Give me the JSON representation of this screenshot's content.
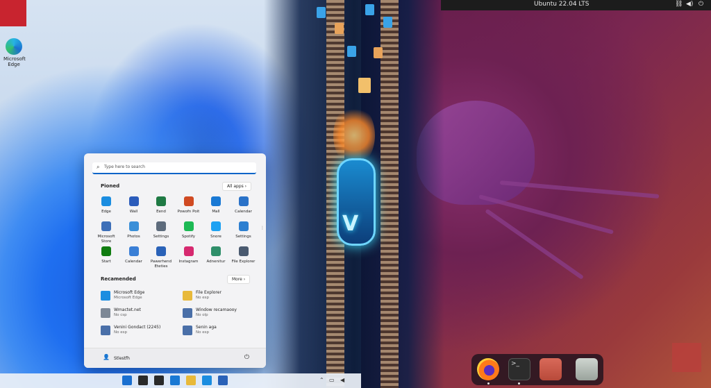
{
  "ubuntu": {
    "top_bar_title": "Ubuntu 22.04 LTS",
    "tray_icons": [
      "network-icon",
      "volume-icon",
      "power-icon"
    ],
    "dock": [
      "firefox-icon",
      "terminal-icon",
      "files-icon",
      "trash-icon"
    ]
  },
  "desktop": {
    "edge_label": "Microsoft Edge"
  },
  "start_menu": {
    "search_placeholder": "Type here to search",
    "pinned_title": "Pioned",
    "all_apps_label": "All apps",
    "pinned": [
      {
        "label": "Edge",
        "icon": "edge-icon",
        "color": "#1b8de0"
      },
      {
        "label": "Wall",
        "icon": "word-icon",
        "color": "#2b5cbb"
      },
      {
        "label": "Eend",
        "icon": "excel-icon",
        "color": "#1f7a44"
      },
      {
        "label": "Powofn Poit",
        "icon": "powerpoint-icon",
        "color": "#d04a22"
      },
      {
        "label": "Mall",
        "icon": "mail-icon",
        "color": "#1a79d4"
      },
      {
        "label": "Calendar",
        "icon": "calendar-icon",
        "color": "#2a72c8"
      },
      {
        "label": "Microsoft Store",
        "icon": "store-icon",
        "color": "#3d6fb8"
      },
      {
        "label": "Photos",
        "icon": "photos-icon",
        "color": "#3a8fd8"
      },
      {
        "label": "Settings",
        "icon": "settings-icon",
        "color": "#5d6b7c"
      },
      {
        "label": "Spotify",
        "icon": "spotify-icon",
        "color": "#1db954"
      },
      {
        "label": "Snore",
        "icon": "twitter-icon",
        "color": "#1da1f2"
      },
      {
        "label": "Settings",
        "icon": "check-icon",
        "color": "#2d7fd0"
      },
      {
        "label": "Start",
        "icon": "xbox-icon",
        "color": "#107c10"
      },
      {
        "label": "Calendar",
        "icon": "calendar-icon",
        "color": "#3a7fd6"
      },
      {
        "label": "Pawerhend Eteties",
        "icon": "monitor-icon",
        "color": "#2a62b8"
      },
      {
        "label": "Instagram",
        "icon": "instagram-icon",
        "color": "#d6296f"
      },
      {
        "label": "Adnenitur",
        "icon": "chat-icon",
        "color": "#2f8f6a"
      },
      {
        "label": "File Explorer",
        "icon": "calculator-icon",
        "color": "#4a5a70"
      }
    ],
    "recommended_title": "Recamended",
    "more_label": "More",
    "recommended": [
      {
        "title": "Microsoft Edge",
        "sub": "Microsoft Edge",
        "icon": "edge-icon",
        "color": "#1b8de0"
      },
      {
        "title": "File Explorer",
        "sub": "No esp",
        "icon": "folder-icon",
        "color": "#e8b93a"
      },
      {
        "title": "Wmactet.net",
        "sub": "No csp",
        "icon": "document-icon",
        "color": "#7d8896"
      },
      {
        "title": "Window recamaooy",
        "sub": "No olp",
        "icon": "document-icon",
        "color": "#4a6fa8"
      },
      {
        "title": "Venini Gondact (2245)",
        "sub": "No esp",
        "icon": "image-icon",
        "color": "#4a6fa8"
      },
      {
        "title": "Senin aga",
        "sub": "No esp",
        "icon": "image-icon",
        "color": "#4a6fa8"
      }
    ],
    "user_name": "Stlestfh"
  },
  "taskbar": {
    "items": [
      "start-icon",
      "search-icon",
      "taskview-icon",
      "widgets-icon",
      "explorer-icon",
      "edge-icon",
      "store-icon"
    ]
  }
}
